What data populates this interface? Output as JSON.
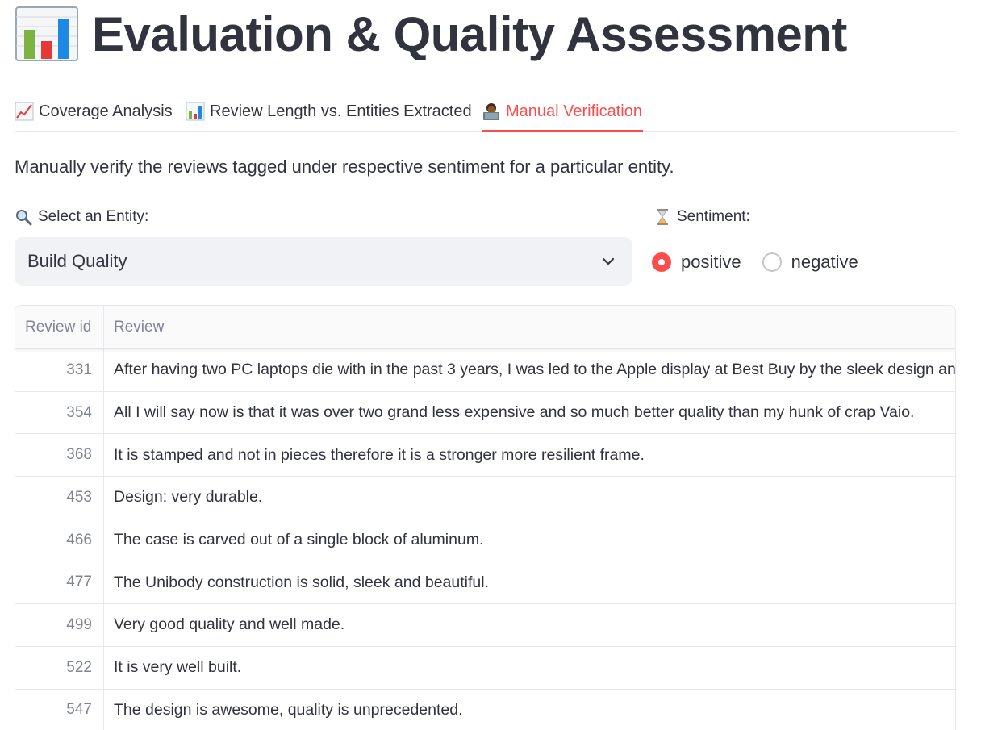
{
  "page": {
    "title": "Evaluation & Quality Assessment",
    "title_icon": "bar-chart-icon"
  },
  "tabs": [
    {
      "label": "Coverage Analysis",
      "icon": "chart-increasing-icon",
      "active": false
    },
    {
      "label": "Review Length vs. Entities Extracted",
      "icon": "bar-chart-icon",
      "active": false
    },
    {
      "label": "Manual Verification",
      "icon": "person-at-laptop-icon",
      "active": true
    }
  ],
  "description": "Manually verify the reviews tagged under respective sentiment for a particular entity.",
  "entity": {
    "label": "Select an Entity:",
    "icon": "magnifier-icon",
    "value": "Build Quality"
  },
  "sentiment": {
    "label": "Sentiment:",
    "icon": "hourglass-icon",
    "options": [
      "positive",
      "negative"
    ],
    "selected": "positive"
  },
  "table": {
    "columns": [
      "Review id",
      "Review"
    ],
    "rows": [
      {
        "id": "331",
        "review": "After having two PC laptops die with in the past 3 years, I was led to the Apple display at Best Buy by the sleek design and"
      },
      {
        "id": "354",
        "review": "All I will say now is that it was over two grand less expensive and so much better quality than my hunk of crap Vaio."
      },
      {
        "id": "368",
        "review": "It is stamped and not in pieces therefore it is a stronger more resilient frame."
      },
      {
        "id": "453",
        "review": "Design: very durable."
      },
      {
        "id": "466",
        "review": "The case is carved out of a single block of aluminum."
      },
      {
        "id": "477",
        "review": "The Unibody construction is solid, sleek and beautiful."
      },
      {
        "id": "499",
        "review": "Very good quality and well made."
      },
      {
        "id": "522",
        "review": "It is very well built."
      },
      {
        "id": "547",
        "review": "The design is awesome, quality is unprecedented."
      }
    ]
  },
  "colors": {
    "accent": "#ff4b4b",
    "text": "#31333f",
    "muted": "#808495",
    "input_bg": "#f0f2f6",
    "border": "#e6e8ee"
  }
}
